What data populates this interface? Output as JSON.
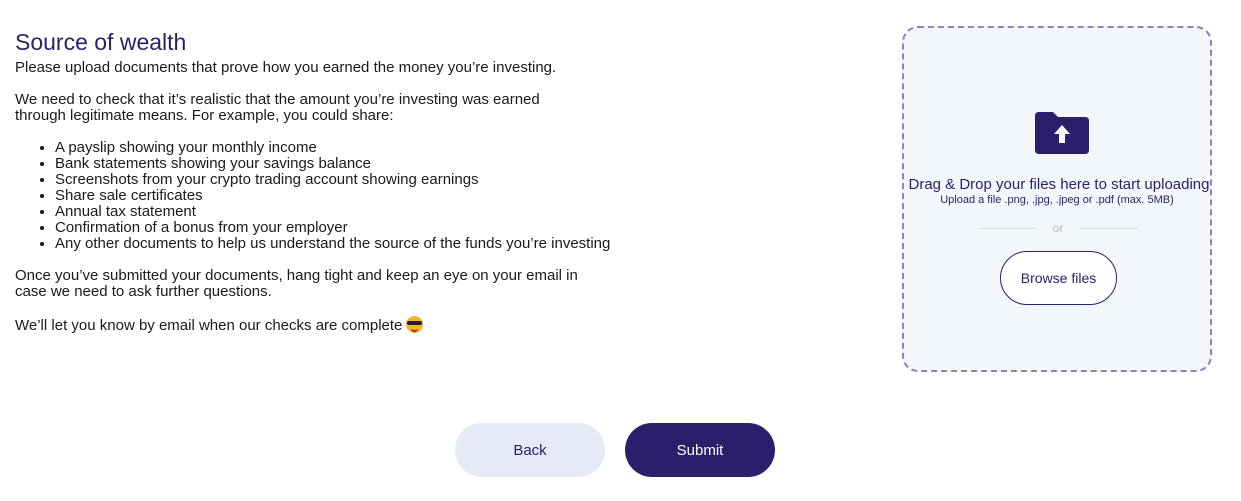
{
  "content": {
    "title": "Source of wealth",
    "intro": "Please upload documents that prove how you earned the money you’re investing.",
    "need": "We need to check that it’s realistic that the amount you’re investing was earned through legitimate means. For example, you could share:",
    "examples": [
      "A payslip showing your monthly income",
      "Bank statements showing your savings balance",
      "Screenshots from your crypto trading account showing earnings",
      "Share sale certificates",
      "Annual tax statement",
      "Confirmation of a bonus from your employer",
      "Any other documents to help us understand the source of the funds you’re investing"
    ],
    "after_submit": "Once you’ve submitted your documents, hang tight and keep an eye on your email in case we need to ask further questions.",
    "final": "We’ll let you know by email when our checks are complete",
    "final_emoji": "smiling-face-with-sunglasses"
  },
  "upload": {
    "icon": "folder-upload-icon",
    "title": "Drag & Drop your files here to start uploading",
    "hint": "Upload a file .png, .jpg, .jpeg or .pdf (max. 5MB)",
    "divider_text": "or",
    "browse_label": "Browse files"
  },
  "actions": {
    "back_label": "Back",
    "submit_label": "Submit"
  },
  "colors": {
    "brand": "#2b1f6b",
    "dropzone_bg": "#f3f6fa",
    "back_bg": "#e5eaf6"
  }
}
